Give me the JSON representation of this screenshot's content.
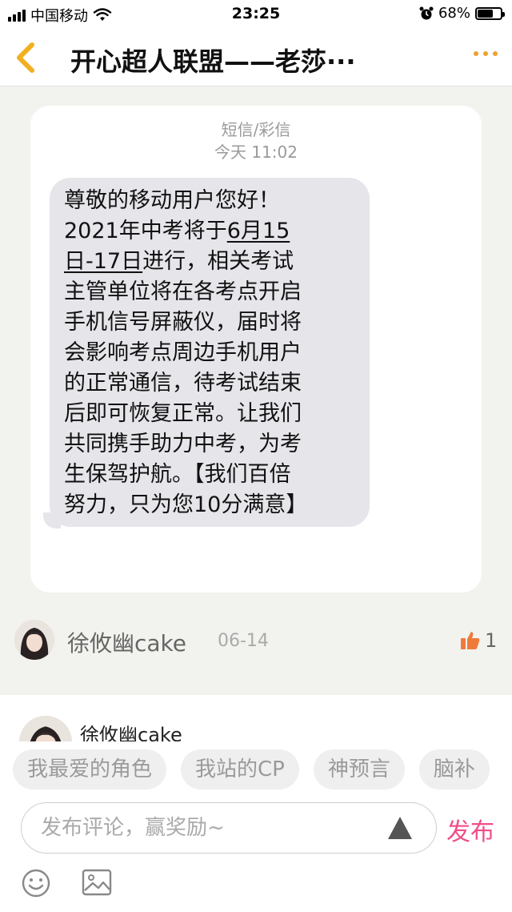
{
  "status_bar": {
    "carrier": "中国移动",
    "time": "23:25",
    "battery_percent": "68%",
    "battery_level": 0.68
  },
  "header": {
    "title": "开心超人联盟——老莎···",
    "accent_color": "#f0a030"
  },
  "message": {
    "type_label": "短信/彩信",
    "time_label": "今天 11:02",
    "lines": [
      "尊敬的移动用户您好！",
      "2021年中考将于",
      "6月15",
      "日-17日",
      "进行，相关考试",
      "主管单位将在各考点开启",
      "手机信号屏蔽仪，届时将",
      "会影响考点周边手机用户",
      "的正常通信，待考试结束",
      "后即可恢复正常。让我们",
      "共同携手助力中考，为考",
      "生保驾护航。【我们百倍",
      "努力，只为您10分满意】"
    ]
  },
  "comment": {
    "author": "徐攸幽cake",
    "date": "06-14",
    "like_count": "1"
  },
  "reply": {
    "author": "徐攸幽cake"
  },
  "composer": {
    "tags": [
      "我最爱的角色",
      "我站的CP",
      "神预言",
      "脑补"
    ],
    "placeholder": "发布评论，赢奖励~",
    "publish_label": "发布",
    "publish_color": "#f04d8a"
  }
}
